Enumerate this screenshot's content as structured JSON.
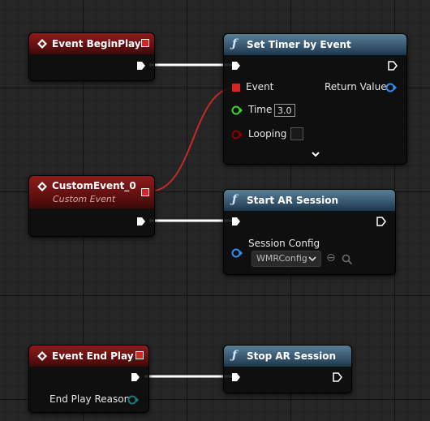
{
  "nodes": {
    "begin_play": {
      "title": "Event BeginPlay"
    },
    "set_timer": {
      "title": "Set Timer by Event",
      "pins": {
        "event": "Event",
        "return_value": "Return Value",
        "time": "Time",
        "time_value": "3.0",
        "looping": "Looping"
      }
    },
    "custom_event": {
      "title": "CustomEvent_0",
      "subtitle": "Custom Event"
    },
    "start_ar": {
      "title": "Start AR Session",
      "pins": {
        "session_config": "Session Config",
        "config_value": "WMRConfig"
      }
    },
    "end_play": {
      "title": "Event End Play",
      "pins": {
        "reason": "End Play Reason"
      }
    },
    "stop_ar": {
      "title": "Stop AR Session"
    }
  },
  "colors": {
    "exec": "#ffffff",
    "delegate": "#d92424",
    "float": "#3ad62f",
    "bool": "#8b0000",
    "object": "#2f8df2",
    "enum": "#1f7a6e",
    "event_header": "#7a1616",
    "function_header": "#3d5f7a"
  },
  "icons": [
    "event-icon",
    "function-icon",
    "expand-chevron-icon",
    "browse-arrow-icon",
    "search-icon"
  ]
}
